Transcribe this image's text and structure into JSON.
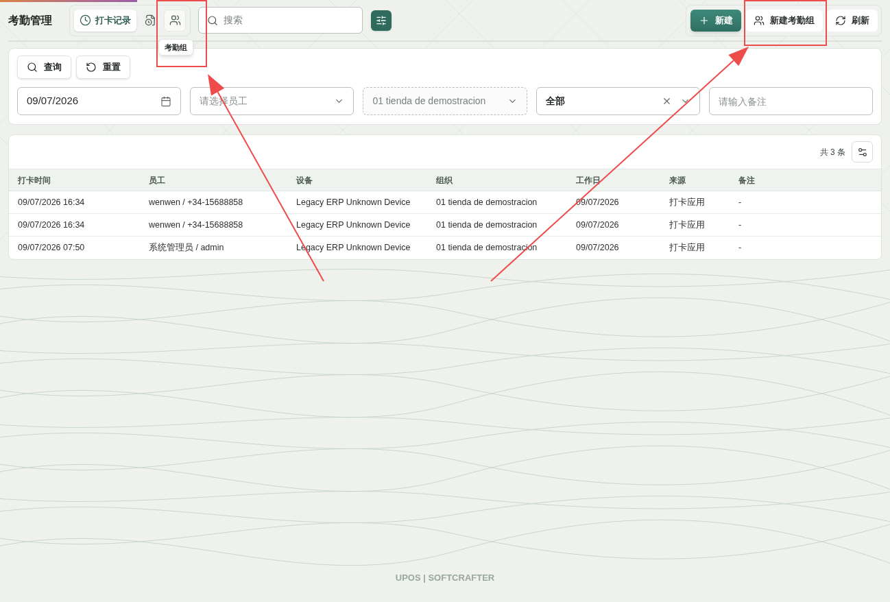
{
  "header": {
    "title": "考勤管理",
    "tabs": [
      {
        "kind": "clock",
        "label": "打卡记录",
        "selected": true
      },
      {
        "kind": "file",
        "selected": false
      },
      {
        "kind": "users",
        "selected": false,
        "tooltip": "考勤组"
      }
    ],
    "search": {
      "placeholder": "搜索"
    },
    "actions": [
      {
        "kind": "add",
        "label": "新建",
        "primary": true
      },
      {
        "kind": "group",
        "label": "新建考勤组",
        "primary": false
      },
      {
        "kind": "refresh",
        "label": "刷新",
        "primary": false
      }
    ]
  },
  "filter": {
    "buttons": [
      {
        "kind": "search",
        "label": "查询"
      },
      {
        "kind": "reset",
        "label": "重置"
      }
    ],
    "fields": [
      {
        "kind": "date",
        "value": "09/07/2026"
      },
      {
        "kind": "select",
        "placeholder": "请选择员工",
        "clearable": false,
        "disabled": false
      },
      {
        "kind": "select",
        "value": "01 tienda de demostracion",
        "clearable": false,
        "disabled": true
      },
      {
        "kind": "select",
        "value": "全部",
        "clearable": true,
        "disabled": false
      },
      {
        "kind": "text",
        "placeholder": "请输入备注"
      }
    ]
  },
  "table": {
    "count": "共 3 条",
    "columns": [
      "打卡时间",
      "员工",
      "设备",
      "组织",
      "工作日",
      "来源",
      "备注"
    ],
    "rows": [
      [
        "09/07/2026 16:34",
        "wenwen / +34-15688858",
        "Legacy ERP Unknown Device",
        "01 tienda de demostracion",
        "09/07/2026",
        "打卡应用",
        "-"
      ],
      [
        "09/07/2026 16:34",
        "wenwen / +34-15688858",
        "Legacy ERP Unknown Device",
        "01 tienda de demostracion",
        "09/07/2026",
        "打卡应用",
        "-"
      ],
      [
        "09/07/2026 07:50",
        "系统管理员 / admin",
        "Legacy ERP Unknown Device",
        "01 tienda de demostracion",
        "09/07/2026",
        "打卡应用",
        "-"
      ]
    ]
  },
  "footer": "UPOS | SOFTCRAFTER"
}
